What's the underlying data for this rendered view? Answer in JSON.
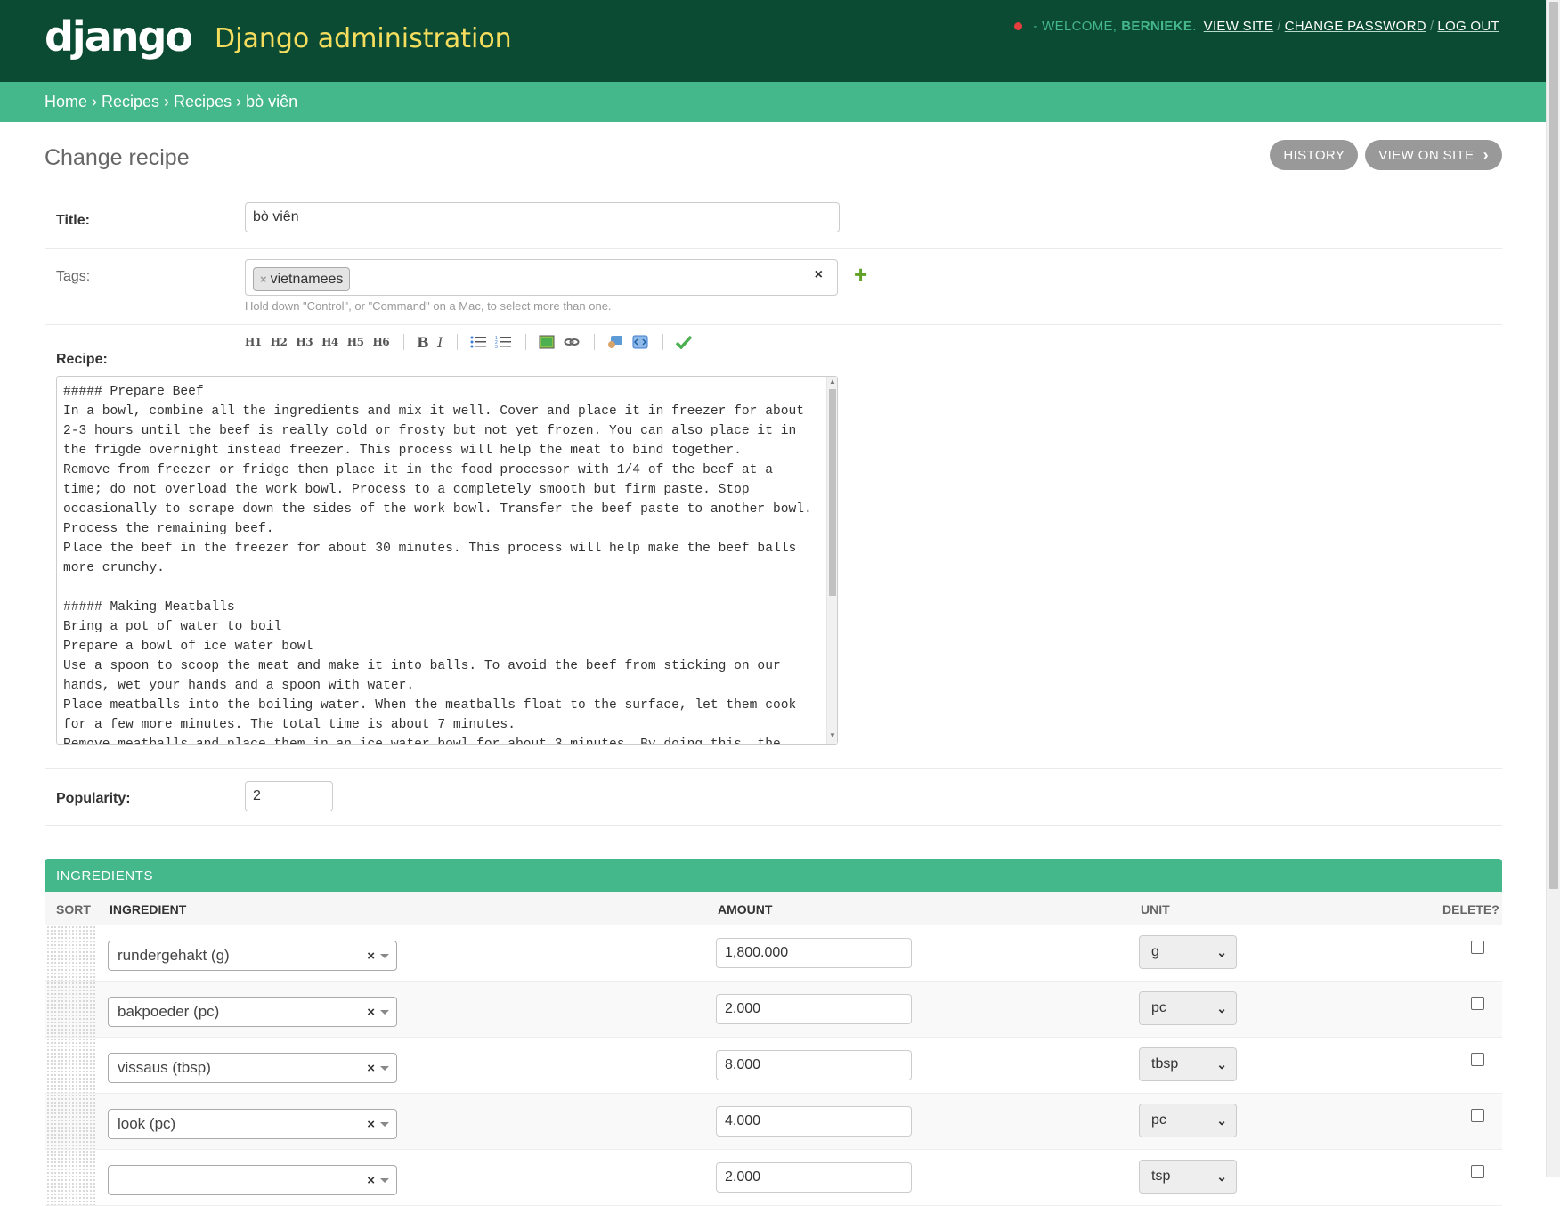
{
  "header": {
    "logo": "django",
    "site_name": "Django administration",
    "welcome": "- WELCOME,",
    "username": "BERNIEKE",
    "view_site": "VIEW SITE",
    "change_password": "CHANGE PASSWORD",
    "log_out": "LOG OUT",
    "status_dot_color": "#e53e3e"
  },
  "breadcrumbs": {
    "home": "Home",
    "app": "Recipes",
    "model": "Recipes",
    "current": "bò viên",
    "separator": "›"
  },
  "page": {
    "title": "Change recipe",
    "history_button": "HISTORY",
    "view_on_site_button": "VIEW ON SITE"
  },
  "form": {
    "title_label": "Title:",
    "title_value": "bò viên",
    "tags_label": "Tags:",
    "tags": [
      "vietnamees"
    ],
    "tags_help": "Hold down \"Control\", or \"Command\" on a Mac, to select more than one.",
    "recipe_label": "Recipe:",
    "toolbar": [
      "H1",
      "H2",
      "H3",
      "H4",
      "H5",
      "H6",
      "B",
      "I"
    ],
    "recipe_text": "##### Prepare Beef\nIn a bowl, combine all the ingredients and mix it well. Cover and place it in freezer for about 2-3 hours until the beef is really cold or frosty but not yet frozen. You can also place it in the frigde overnight instead freezer. This process will help the meat to bind together.\nRemove from freezer or fridge then place it in the food processor with 1/4 of the beef at a time; do not overload the work bowl. Process to a completely smooth but firm paste. Stop occasionally to scrape down the sides of the work bowl. Transfer the beef paste to another bowl. Process the remaining beef.\nPlace the beef in the freezer for about 30 minutes. This process will help make the beef balls more crunchy.\n\n##### Making Meatballs\nBring a pot of water to boil\nPrepare a bowl of ice water bowl\nUse a spoon to scoop the meat and make it into balls. To avoid the beef from sticking on our hands, wet your hands and a spoon with water.\nPlace meatballs into the boiling water. When the meatballs float to the surface, let them cook for a few more minutes. The total time is about 7 minutes.\nRemove meatballs and place them in an ice water bowl for about 3 minutes. By doing this, the",
    "popularity_label": "Popularity:",
    "popularity_value": "2"
  },
  "ingredients": {
    "heading": "INGREDIENTS",
    "columns": {
      "sort": "SORT",
      "ingredient": "INGREDIENT",
      "amount": "AMOUNT",
      "unit": "UNIT",
      "delete": "DELETE?"
    },
    "rows": [
      {
        "ingredient": "rundergehakt (g)",
        "amount": "1,800.000",
        "unit": "g"
      },
      {
        "ingredient": "bakpoeder (pc)",
        "amount": "2.000",
        "unit": "pc"
      },
      {
        "ingredient": "vissaus (tbsp)",
        "amount": "8.000",
        "unit": "tbsp"
      },
      {
        "ingredient": "look (pc)",
        "amount": "4.000",
        "unit": "pc"
      },
      {
        "ingredient": "",
        "amount": "2.000",
        "unit": "tsp"
      }
    ]
  },
  "colors": {
    "header_bg": "#0c4b33",
    "accent": "#44b78b",
    "site_name": "#f5dd5d"
  }
}
